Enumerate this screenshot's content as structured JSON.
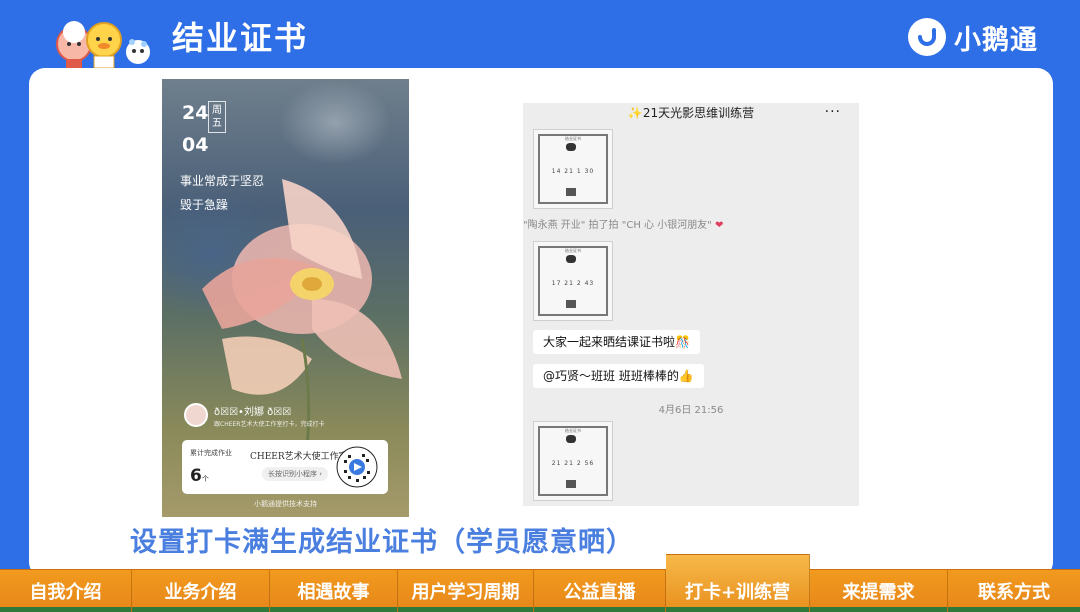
{
  "header": {
    "title": "结业证书",
    "brand_name": "小鹅通"
  },
  "poster": {
    "day": "24",
    "month": "04",
    "weekday": "周五",
    "quote_line1": "事业常成于坚忍",
    "quote_line2": "毁于急躁",
    "user_name": "ð☒☒•刘娜 ð☒☒",
    "user_message": "跟CHEER艺术大使工作室打卡，完成打卡",
    "stat_label": "累计完成作业",
    "stat_value": "6",
    "stat_unit": "个",
    "studio_name": "CHEER艺术大使工作室",
    "mini_program_hint": "长按识别小程序 ›",
    "support_text": "小鹅通提供技术支持"
  },
  "chat": {
    "title": "✨21天光影思维训练营",
    "more": "···",
    "cert_title": "结业证书",
    "cert1_nums": "14  21  1  30",
    "system_message": "\"陶永燕 开业\" 拍了拍 \"CH 心 小银河朋友\"",
    "cert2_nums": "17  21  2  43",
    "bubble1": "大家一起来晒结课证书啦🎊",
    "bubble2": "@巧贤～班班 班班棒棒的👍",
    "timestamp": "4月6日 21:56",
    "cert3_nums": "21  21  2  56"
  },
  "caption": "设置打卡满生成结业证书（学员愿意晒）",
  "nav": {
    "items": [
      {
        "label": "自我介绍"
      },
      {
        "label": "业务介绍"
      },
      {
        "label": "相遇故事"
      },
      {
        "label": "用户学习周期"
      },
      {
        "label": "公益直播"
      },
      {
        "label": "打卡+训练营",
        "active": true
      },
      {
        "label": "来提需求"
      },
      {
        "label": "联系方式"
      }
    ]
  },
  "colors": {
    "header_bg": "#2e6ee6",
    "caption": "#4a7fe0",
    "nav_bg": "#f29a1e",
    "nav_active": "#f7b94a"
  }
}
